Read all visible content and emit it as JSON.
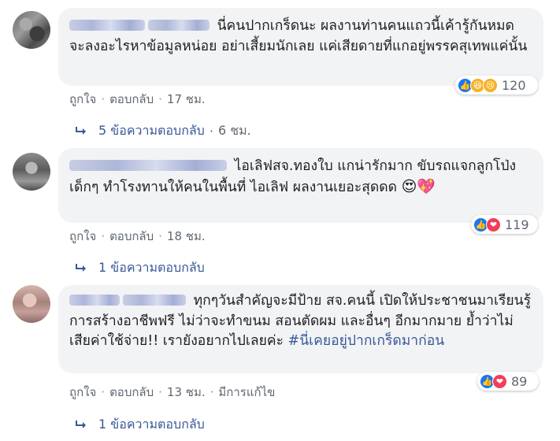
{
  "comments": [
    {
      "text": "นี่คนปากเกร็ดนะ ผลงานท่านคนแถวนี้เค้ารู้กันหมด จะลงอะไรหาข้อมูลหน่อย อย่าเสี้ยมนักเลย แค่เสียดายที่แกอยู่พรรคสุเทพแค่นั้น",
      "reaction_count": "120",
      "reaction_icons": [
        "like-icon",
        "haha-icon",
        "sad-icon"
      ],
      "like": "ถูกใจ",
      "reply": "ตอบกลับ",
      "time": "17 ชม.",
      "replies_label": "5 ข้อความตอบกลับ",
      "replies_time": "6 ชม."
    },
    {
      "text": "ไอเลิฟสจ.ทองใบ แกน่ารักมาก ขับรถแจกลูกโป่งเด็กๆ ทำโรงทานให้คนในพื้นที่ ไอเลิฟ ผลงานเยอะสุดดด",
      "emojis": "😍💖",
      "reaction_count": "119",
      "reaction_icons": [
        "like-icon",
        "love-icon"
      ],
      "like": "ถูกใจ",
      "reply": "ตอบกลับ",
      "time": "18 ชม.",
      "replies_label": "1 ข้อความตอบกลับ"
    },
    {
      "text": "ทุกๆวันสำคัญจะมีป้าย สจ.คนนี้ เปิดให้ประชาชนมาเรียนรู้การสร้างอาชีพฟรี ไม่ว่าจะทำขนม สอนตัดผม และอื่นๆ อีกมากมาย ย้ำว่าไม่เสียค่าใช้จ่าย!! เรายังอยากไปเลยค่ะ",
      "hashtag": "#นี่เคยอยู่ปากเกร็ดมาก่อน",
      "reaction_count": "89",
      "reaction_icons": [
        "like-icon",
        "love-icon"
      ],
      "like": "ถูกใจ",
      "reply": "ตอบกลับ",
      "time": "13 ชม.",
      "edited": "มีการแก้ไข",
      "replies_label": "1 ข้อความตอบกลับ"
    }
  ],
  "colors": {
    "link": "#385898",
    "meta": "#606770",
    "bubble": "#f2f3f5",
    "like": "#1877f2",
    "love": "#f33e58"
  }
}
